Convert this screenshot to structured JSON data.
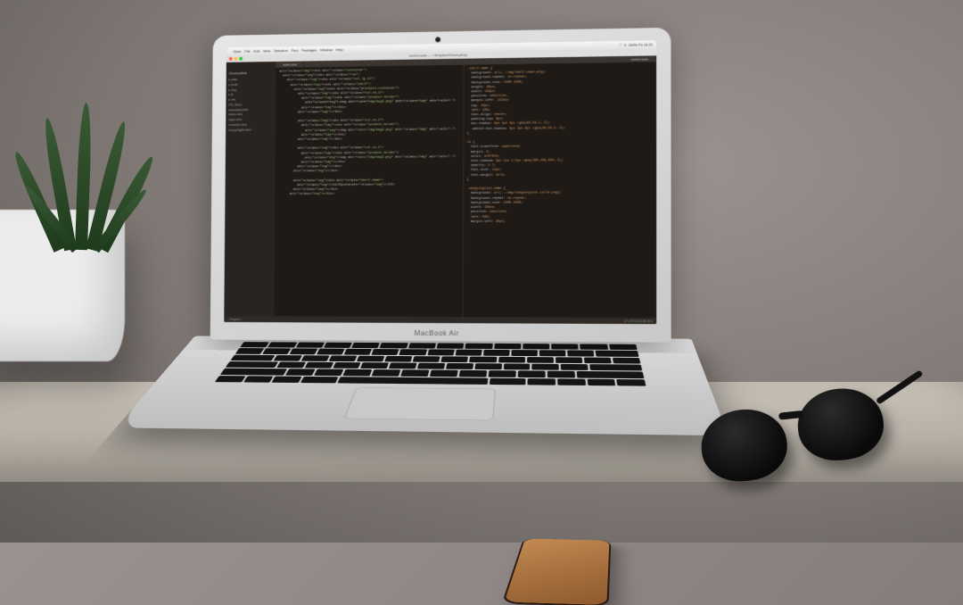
{
  "scene": {
    "laptop_model": "MacBook Air"
  },
  "menubar": {
    "apple": "",
    "items": [
      "Atom",
      "File",
      "Edit",
      "View",
      "Selection",
      "Find",
      "Packages",
      "Window",
      "Help"
    ],
    "right": "♡  ⏚  100%  Fri 14:22"
  },
  "window": {
    "title": "screen.scss — ~/Dropbox/Grocery/img"
  },
  "tabs": {
    "left": "index.html",
    "right": "screen.scss"
  },
  "sidebar": {
    "header": "GroceryWeb",
    "items": [
      "▸ sass",
      "▸ fonts",
      "▸ img",
      "▸ js",
      "▸ css",
      "  DS_Store",
      "  download.html",
      "  index.html",
      "  login.html",
      "  modules.html",
      "  shoppinglist.html"
    ]
  },
  "code_left": [
    "<div class=\"container\">",
    "  <div class=\"row\">",
    "    <div class=\"col-lg-12\">",
    "      <div class=\"shelf\">",
    "        <div class=\"products-container\">",
    "          <div class=\"col-xs-4\">",
    "            <div class=\"product-holder\">",
    "              <img src=\"img/bag1.png\" class=\"img\" alt=\"…\">",
    "            </div>",
    "          </div>",
    "",
    "          <div class=\"col-xs-4\">",
    "            <div class=\"product-holder\">",
    "              <img src=\"img/bag2.png\" class=\"img\" alt=\"…\">",
    "            </div>",
    "          </div>",
    "",
    "          <div class=\"col-xs-4\">",
    "            <div class=\"product-holder\">",
    "              <img src=\"img/bag3.png\" class=\"img\" alt=\"…\">",
    "            </div>",
    "          </div>",
    "        </div>",
    "",
    "        <div class=\"shelf-name\">",
    "          <h4>Popular</h4>",
    "        </div>",
    "      </div>"
  ],
  "code_right": [
    ".shelf-name {",
    "  background: url(../img/shelf-name.png);",
    "  background-repeat: no-repeat;",
    "  background-size: 100% 100%;",
    "  height: 38px;",
    "  width: 130px;",
    "  position: absolute;",
    "  margin-left: -130px;",
    "  top: 20px;",
    "  left: 50%;",
    "  text-align: center;",
    "  padding-top: 6px;",
    "  box-shadow: 0px 3px 0px rgba(80,50,1,.3);",
    "  -webkit-box-shadow: 0px 3px 0px rgba(80,50,1,.3);",
    "}",
    "",
    "h4 {",
    "  text-transform: uppercase;",
    "  margin: 0;",
    "  color: #f0f0f0;",
    "  text-shadow: 0px 1px 1.5px rgba(200,200,200,.5);",
    "  opacity: 0.7;",
    "  font-size: 12px;",
    "  font-weight: bold;",
    "}",
    "",
    ".shoppinglist-name {",
    "  background: url(../img/shoppinglist-title.png);",
    "  background-repeat: no-repeat;",
    "  background-size: 100% 100%;",
    "  width: 180px;",
    "  position: absolute;",
    "  left: 50%;",
    "  margin-left: 30px;"
  ],
  "status": {
    "left": "⌂  Project 1",
    "right": "LF  UTF-8  SCSS  ⚙ 0"
  }
}
